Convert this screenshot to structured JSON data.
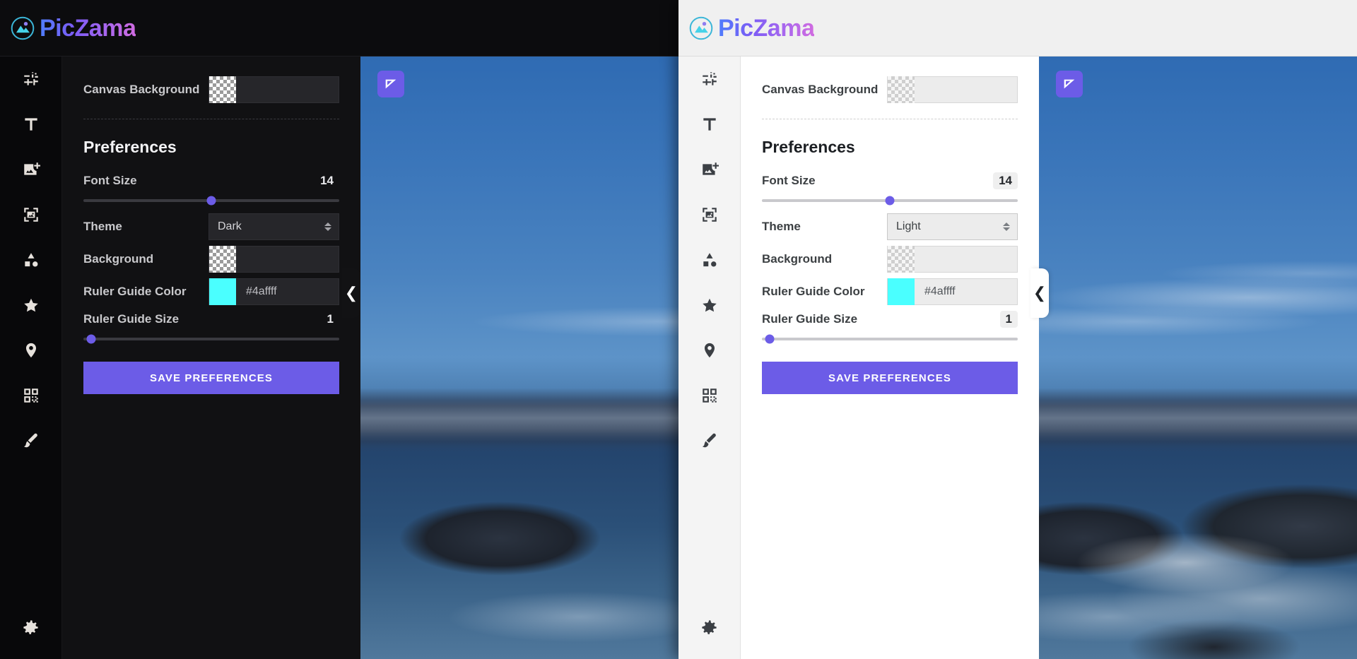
{
  "app": {
    "brand": "PicZama",
    "logo_icon": "image-circle-icon",
    "brand_gradient_from": "#4f7dfc",
    "brand_gradient_to": "#d06be0",
    "accent_color": "#6c5ce7"
  },
  "sidebar": {
    "items": [
      {
        "icon": "adjustments-sliders-icon",
        "name": "sidebar-item-adjustments"
      },
      {
        "icon": "text-t-icon",
        "name": "sidebar-item-text"
      },
      {
        "icon": "add-image-icon",
        "name": "sidebar-item-add-image"
      },
      {
        "icon": "frame-image-icon",
        "name": "sidebar-item-frame"
      },
      {
        "icon": "shapes-icon",
        "name": "sidebar-item-shapes"
      },
      {
        "icon": "star-icon",
        "name": "sidebar-item-favorites"
      },
      {
        "icon": "location-pin-icon",
        "name": "sidebar-item-location"
      },
      {
        "icon": "qr-code-icon",
        "name": "sidebar-item-qrcode"
      },
      {
        "icon": "paint-brush-icon",
        "name": "sidebar-item-brush"
      }
    ],
    "bottom": {
      "icon": "gear-icon",
      "name": "sidebar-item-settings"
    }
  },
  "panel": {
    "canvas_background": {
      "label": "Canvas Background",
      "swatch": "transparent-checker",
      "value": ""
    },
    "section_title": "Preferences",
    "font_size": {
      "label": "Font Size",
      "value": "14",
      "slider_percent": 50
    },
    "theme_dark": {
      "label": "Theme",
      "value": "Dark",
      "options": [
        "Dark",
        "Light"
      ]
    },
    "theme_light": {
      "label": "Theme",
      "value": "Light",
      "options": [
        "Dark",
        "Light"
      ]
    },
    "background": {
      "label": "Background",
      "swatch": "transparent-checker",
      "value": ""
    },
    "ruler_guide_color": {
      "label": "Ruler Guide Color",
      "value": "#4affff",
      "swatch_color": "#4affff"
    },
    "ruler_guide_size": {
      "label": "Ruler Guide Size",
      "value": "1",
      "slider_percent": 3
    },
    "save_button": "SAVE PREFERENCES"
  },
  "canvas": {
    "tool_badge_icon": "ruler-triangle-icon",
    "collapse_icon": "chevron-left-icon",
    "photo_description": "Coastal seascape with snow-capped mountains, dark rocks and breaking surf at dusk"
  }
}
